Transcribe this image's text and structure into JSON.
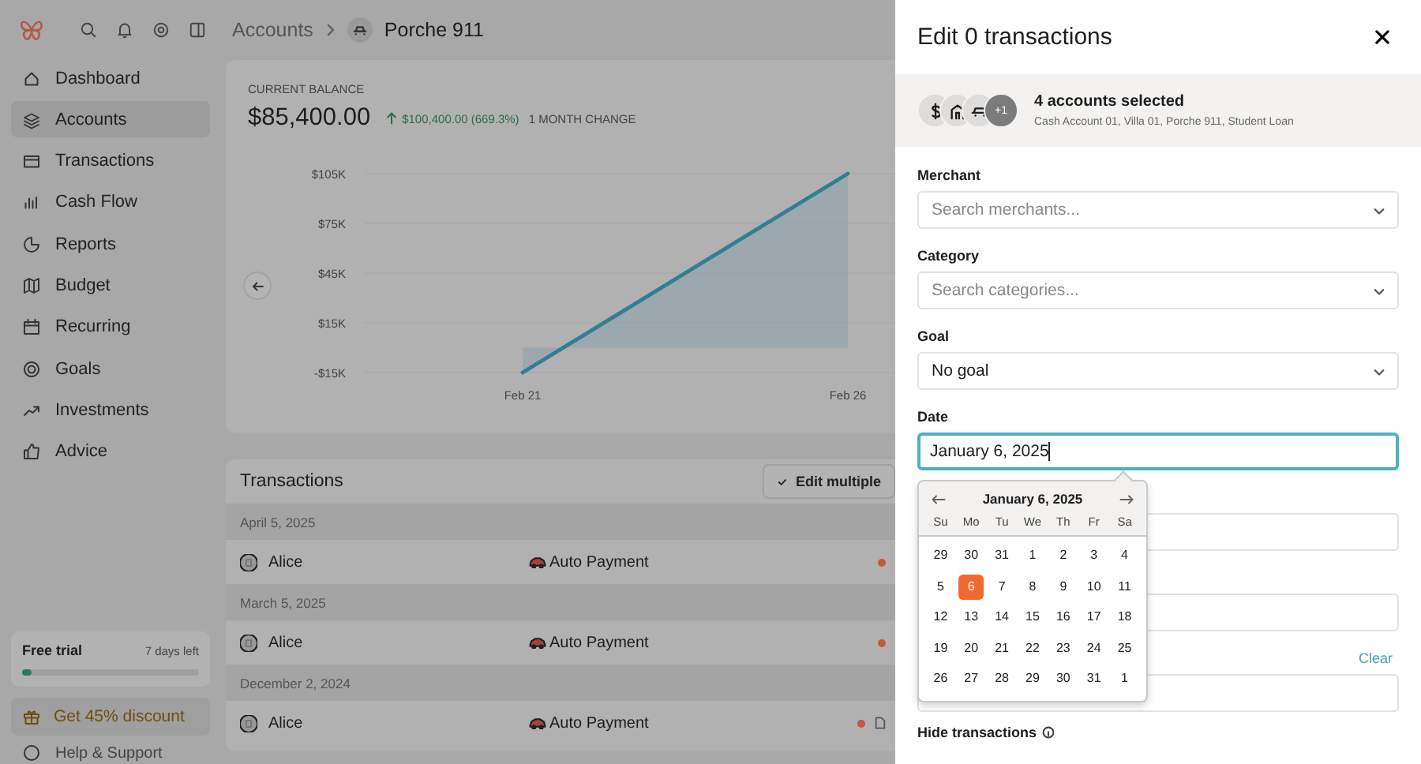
{
  "sidebar": {
    "nav": [
      {
        "label": "Dashboard",
        "selected": false
      },
      {
        "label": "Accounts",
        "selected": true
      },
      {
        "label": "Transactions",
        "selected": false
      },
      {
        "label": "Cash Flow",
        "selected": false
      },
      {
        "label": "Reports",
        "selected": false
      },
      {
        "label": "Budget",
        "selected": false
      },
      {
        "label": "Recurring",
        "selected": false
      },
      {
        "label": "Goals",
        "selected": false
      },
      {
        "label": "Investments",
        "selected": false
      },
      {
        "label": "Advice",
        "selected": false
      }
    ],
    "trial": {
      "title": "Free trial",
      "remaining": "7 days left",
      "level": 0.05
    },
    "promo": "Get 45% discount",
    "help": "Help & Support"
  },
  "breadcrumb": [
    "Accounts",
    "Porche 911"
  ],
  "balance": {
    "label": "CURRENT BALANCE",
    "amount": "$85,400.00",
    "change": "$100,400.00 (669.3%)",
    "change_label": "1 MONTH CHANGE",
    "chart_data": {
      "type": "area",
      "x": [
        "Feb 21",
        "Feb 26"
      ],
      "series": [
        {
          "color": "#2f7f95",
          "values": [
            -15000,
            105000
          ]
        }
      ],
      "grid": true,
      "ylim": [
        -15000,
        105000
      ],
      "yticks": [
        {
          "value": 105000,
          "label": "$105K"
        },
        {
          "value": 75000,
          "label": "$75K"
        },
        {
          "value": 45000,
          "label": "$45K"
        },
        {
          "value": 15000,
          "label": "$15K"
        },
        {
          "value": -15000,
          "label": "-$15K"
        }
      ]
    }
  },
  "transactions": {
    "title": "Transactions",
    "edit_button": "Edit multiple",
    "groups": [
      {
        "date": "April 5, 2025",
        "rows": [
          {
            "merchant": "Alice",
            "category": "Auto Payment",
            "attachment": false
          }
        ]
      },
      {
        "date": "March 5, 2025",
        "rows": [
          {
            "merchant": "Alice",
            "category": "Auto Payment",
            "attachment": false
          }
        ]
      },
      {
        "date": "December 2, 2024",
        "rows": [
          {
            "merchant": "Alice",
            "category": "Auto Payment",
            "attachment": true
          }
        ]
      }
    ]
  },
  "panel": {
    "title": "Edit 0 transactions",
    "accounts": {
      "title": "4 accounts selected",
      "names": "Cash Account 01, Villa 01, Porche 911, Student Loan",
      "extra": "+1"
    },
    "fields": [
      {
        "kind": "select",
        "label": "Merchant",
        "placeholder": "Search merchants..."
      },
      {
        "kind": "select",
        "label": "Category",
        "placeholder": "Search categories..."
      },
      {
        "kind": "select",
        "label": "Goal",
        "value": "No goal"
      },
      {
        "kind": "date",
        "label": "Date",
        "value": "January 6, 2025",
        "focused": true
      },
      {
        "kind": "select"
      },
      {
        "kind": "select"
      },
      {
        "kind": "select",
        "action": "Clear"
      }
    ],
    "footer_label": "Hide transactions",
    "calendar": {
      "title": "January 6, 2025",
      "weekdays": [
        "Su",
        "Mo",
        "Tu",
        "We",
        "Th",
        "Fr",
        "Sa"
      ],
      "weeks": [
        [
          {
            "day": "29",
            "selected": false
          },
          {
            "day": "30",
            "selected": false
          },
          {
            "day": "31",
            "selected": false
          },
          {
            "day": "1",
            "selected": false
          },
          {
            "day": "2",
            "selected": false
          },
          {
            "day": "3",
            "selected": false
          },
          {
            "day": "4",
            "selected": false
          }
        ],
        [
          {
            "day": "5",
            "selected": false
          },
          {
            "day": "6",
            "selected": true
          },
          {
            "day": "7",
            "selected": false
          },
          {
            "day": "8",
            "selected": false
          },
          {
            "day": "9",
            "selected": false
          },
          {
            "day": "10",
            "selected": false
          },
          {
            "day": "11",
            "selected": false
          }
        ],
        [
          {
            "day": "12",
            "selected": false
          },
          {
            "day": "13",
            "selected": false
          },
          {
            "day": "14",
            "selected": false
          },
          {
            "day": "15",
            "selected": false
          },
          {
            "day": "16",
            "selected": false
          },
          {
            "day": "17",
            "selected": false
          },
          {
            "day": "18",
            "selected": false
          }
        ],
        [
          {
            "day": "19",
            "selected": false
          },
          {
            "day": "20",
            "selected": false
          },
          {
            "day": "21",
            "selected": false
          },
          {
            "day": "22",
            "selected": false
          },
          {
            "day": "23",
            "selected": false
          },
          {
            "day": "24",
            "selected": false
          },
          {
            "day": "25",
            "selected": false
          }
        ],
        [
          {
            "day": "26",
            "selected": false
          },
          {
            "day": "27",
            "selected": false
          },
          {
            "day": "28",
            "selected": false
          },
          {
            "day": "29",
            "selected": false
          },
          {
            "day": "30",
            "selected": false
          },
          {
            "day": "31",
            "selected": false
          },
          {
            "day": "1",
            "selected": false
          }
        ]
      ]
    }
  }
}
